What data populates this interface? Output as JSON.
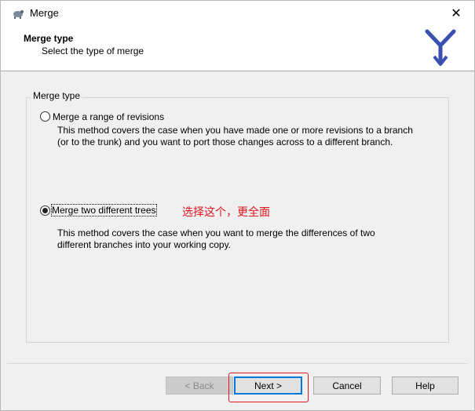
{
  "window": {
    "title": "Merge",
    "close_glyph": "✕",
    "app_icon": "tortoise-icon"
  },
  "header": {
    "title": "Merge type",
    "subtitle": "Select the type of merge",
    "logo_icon": "merge-logo-icon"
  },
  "group": {
    "legend": "Merge type",
    "options": [
      {
        "label": "Merge a range of revisions",
        "checked": false,
        "desc1": "This method covers the case when you have made one or more revisions to a branch",
        "desc2": "(or to the trunk) and you want to port those changes across to a different branch."
      },
      {
        "label": "Merge two different trees",
        "checked": true,
        "desc1": "This method covers the case when you want to merge the differences of two",
        "desc2": "different branches into your working copy."
      }
    ]
  },
  "annotation": {
    "text": "选择这个，更全面",
    "color": "#e0141e"
  },
  "buttons": {
    "back": "< Back",
    "next": "Next >",
    "cancel": "Cancel",
    "help": "Help"
  },
  "colors": {
    "accent": "#0078d7",
    "annotation": "#e0141e",
    "logo": "#3a4fb0"
  }
}
